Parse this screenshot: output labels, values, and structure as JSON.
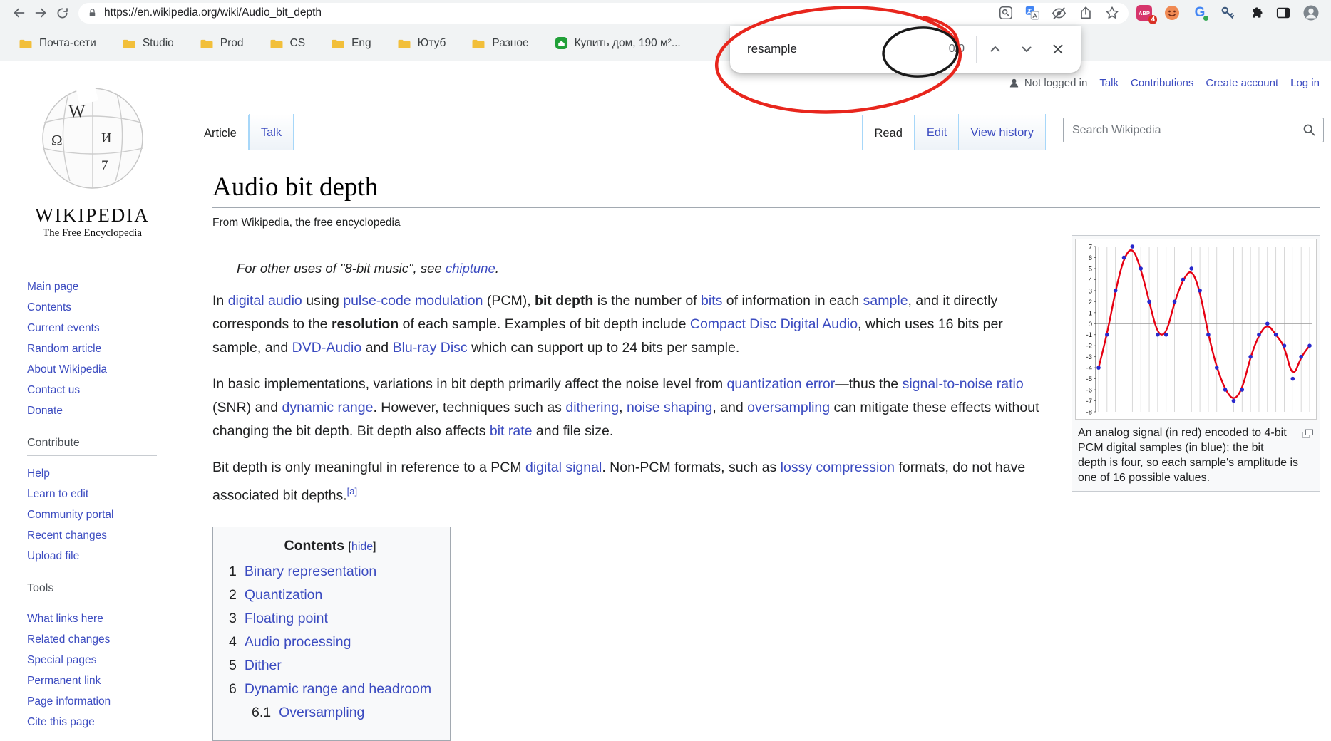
{
  "annotations": {
    "red": "#e8261d",
    "black": "#1a1a1a"
  },
  "browser": {
    "url": "https://en.wikipedia.org/wiki/Audio_bit_depth",
    "find_bar": {
      "query": "resample",
      "count": "0/0"
    },
    "bookmarks": [
      {
        "label": "Почта-сети"
      },
      {
        "label": "Studio"
      },
      {
        "label": "Prod"
      },
      {
        "label": "CS"
      },
      {
        "label": "Eng"
      },
      {
        "label": "Ютуб"
      },
      {
        "label": "Разное"
      },
      {
        "label": "Купить дом, 190 м²..."
      }
    ],
    "extensions": {
      "abp_label": "ABP",
      "abp_badge": "4",
      "g_label": "G"
    }
  },
  "wiki": {
    "logo_title": "WIKIPEDIA",
    "logo_subtitle": "The Free Encyclopedia",
    "logo_glyphs": [
      "W",
      "Ω",
      "И",
      "7"
    ],
    "personal": {
      "not_logged_in": "Not logged in",
      "links": [
        "Talk",
        "Contributions",
        "Create account",
        "Log in"
      ]
    },
    "tabs_left": [
      "Article",
      "Talk"
    ],
    "tabs_right": [
      "Read",
      "Edit",
      "View history"
    ],
    "search_placeholder": "Search Wikipedia",
    "sidebar": {
      "nav": [
        "Main page",
        "Contents",
        "Current events",
        "Random article",
        "About Wikipedia",
        "Contact us",
        "Donate"
      ],
      "contribute_header": "Contribute",
      "contribute": [
        "Help",
        "Learn to edit",
        "Community portal",
        "Recent changes",
        "Upload file"
      ],
      "tools_header": "Tools",
      "tools": [
        "What links here",
        "Related changes",
        "Special pages",
        "Permanent link",
        "Page information",
        "Cite this page"
      ]
    }
  },
  "article": {
    "title": "Audio bit depth",
    "site_sub": "From Wikipedia, the free encyclopedia",
    "hatnote": [
      {
        "t": "plain",
        "x": "For other uses of \"8-bit music\", see "
      },
      {
        "t": "link",
        "x": "chiptune"
      },
      {
        "t": "plain",
        "x": "."
      }
    ],
    "p1": [
      {
        "t": "plain",
        "x": "In "
      },
      {
        "t": "link",
        "x": "digital audio"
      },
      {
        "t": "plain",
        "x": " using "
      },
      {
        "t": "link",
        "x": "pulse-code modulation"
      },
      {
        "t": "plain",
        "x": " (PCM), "
      },
      {
        "t": "bold",
        "x": "bit depth"
      },
      {
        "t": "plain",
        "x": " is the number of "
      },
      {
        "t": "link",
        "x": "bits"
      },
      {
        "t": "plain",
        "x": " of information in each "
      },
      {
        "t": "link",
        "x": "sample"
      },
      {
        "t": "plain",
        "x": ", and it directly corresponds to the "
      },
      {
        "t": "bold",
        "x": "resolution"
      },
      {
        "t": "plain",
        "x": " of each sample. Examples of bit depth include "
      },
      {
        "t": "link",
        "x": "Compact Disc Digital Audio"
      },
      {
        "t": "plain",
        "x": ", which uses 16 bits per sample, and "
      },
      {
        "t": "link",
        "x": "DVD-Audio"
      },
      {
        "t": "plain",
        "x": " and "
      },
      {
        "t": "link",
        "x": "Blu-ray Disc"
      },
      {
        "t": "plain",
        "x": " which can support up to 24 bits per sample."
      }
    ],
    "p2": [
      {
        "t": "plain",
        "x": "In basic implementations, variations in bit depth primarily affect the noise level from "
      },
      {
        "t": "link",
        "x": "quantization error"
      },
      {
        "t": "plain",
        "x": "—thus the "
      },
      {
        "t": "link",
        "x": "signal-to-noise ratio"
      },
      {
        "t": "plain",
        "x": " (SNR) and "
      },
      {
        "t": "link",
        "x": "dynamic range"
      },
      {
        "t": "plain",
        "x": ". However, techniques such as "
      },
      {
        "t": "link",
        "x": "dithering"
      },
      {
        "t": "plain",
        "x": ", "
      },
      {
        "t": "link",
        "x": "noise shaping"
      },
      {
        "t": "plain",
        "x": ", and "
      },
      {
        "t": "link",
        "x": "oversampling"
      },
      {
        "t": "plain",
        "x": " can mitigate these effects without changing the bit depth. Bit depth also affects "
      },
      {
        "t": "link",
        "x": "bit rate"
      },
      {
        "t": "plain",
        "x": " and file size."
      }
    ],
    "p3": [
      {
        "t": "plain",
        "x": "Bit depth is only meaningful in reference to a PCM "
      },
      {
        "t": "link",
        "x": "digital signal"
      },
      {
        "t": "plain",
        "x": ". Non-PCM formats, such as "
      },
      {
        "t": "link",
        "x": "lossy compression"
      },
      {
        "t": "plain",
        "x": " formats, do not have associated bit depths."
      },
      {
        "t": "sup",
        "x": "[a]"
      }
    ],
    "toc": {
      "title": "Contents",
      "bracket_l": "[",
      "hide_label": "hide",
      "bracket_r": "]",
      "items": [
        {
          "num": "1",
          "label": "Binary representation",
          "indent": 0
        },
        {
          "num": "2",
          "label": "Quantization",
          "indent": 0
        },
        {
          "num": "3",
          "label": "Floating point",
          "indent": 0
        },
        {
          "num": "4",
          "label": "Audio processing",
          "indent": 0
        },
        {
          "num": "5",
          "label": "Dither",
          "indent": 0
        },
        {
          "num": "6",
          "label": "Dynamic range and headroom",
          "indent": 0
        },
        {
          "num": "6.1",
          "label": "Oversampling",
          "indent": 1
        }
      ]
    },
    "figure": {
      "caption": "An analog signal (in red) encoded to 4-bit PCM digital samples (in blue); the bit depth is four, so each sample's amplitude is one of 16 possible values.",
      "chart": {
        "type": "line",
        "ylim": [
          -8,
          7
        ],
        "samples": [
          -4,
          -1,
          3,
          6,
          7,
          5,
          2,
          -1,
          -1,
          2,
          4,
          5,
          3,
          -1,
          -4,
          -6,
          -7,
          -6,
          -3,
          -1,
          0,
          -1,
          -2,
          -5,
          -3,
          -2
        ],
        "curve_color": "#e60012",
        "sample_color": "#2929cc"
      }
    }
  }
}
